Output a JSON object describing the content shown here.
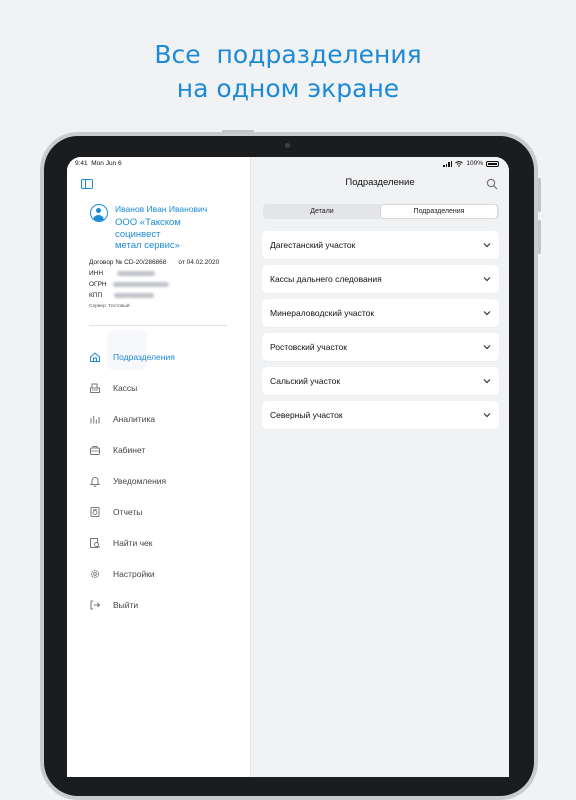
{
  "headline": {
    "line1": "Все  подразделения",
    "line2": "на одном экране"
  },
  "status": {
    "time": "9:41",
    "date": "Mon Jun 6",
    "battery": "100%"
  },
  "profile": {
    "name": "Иванов Иван Иванович",
    "org_line1": "ООО «Такском",
    "org_line2": "социнвест",
    "org_line3": "метал сервис»",
    "contract_label": "Договор № CD-20/286868",
    "contract_date": "от 04.02.2020",
    "inn_label": "ИНН",
    "ogrn_label": "ОГРН",
    "kpp_label": "КПП",
    "server": "Сервер: Тестовый"
  },
  "menu": [
    {
      "label": "Подразделения",
      "icon": "home-icon",
      "active": true
    },
    {
      "label": "Кассы",
      "icon": "register-icon",
      "active": false
    },
    {
      "label": "Аналитика",
      "icon": "chart-icon",
      "active": false
    },
    {
      "label": "Кабинет",
      "icon": "briefcase-icon",
      "active": false
    },
    {
      "label": "Уведомления",
      "icon": "bell-icon",
      "active": false
    },
    {
      "label": "Отчеты",
      "icon": "report-icon",
      "active": false
    },
    {
      "label": "Найти чек",
      "icon": "find-receipt-icon",
      "active": false
    },
    {
      "label": "Настройки",
      "icon": "gear-icon",
      "active": false
    },
    {
      "label": "Выйти",
      "icon": "logout-icon",
      "active": false
    }
  ],
  "main": {
    "title": "Подразделение",
    "segments": [
      "Детали",
      "Подразделения"
    ],
    "selected_segment": "Подразделения",
    "units": [
      "Дагестанский участок",
      "Кассы дальнего следования",
      "Минераловодский участок",
      "Ростовский участок",
      "Сальский участок",
      "Северный участок"
    ]
  },
  "colors": {
    "accent": "#1d8ad6",
    "background": "#f1f2f4"
  }
}
